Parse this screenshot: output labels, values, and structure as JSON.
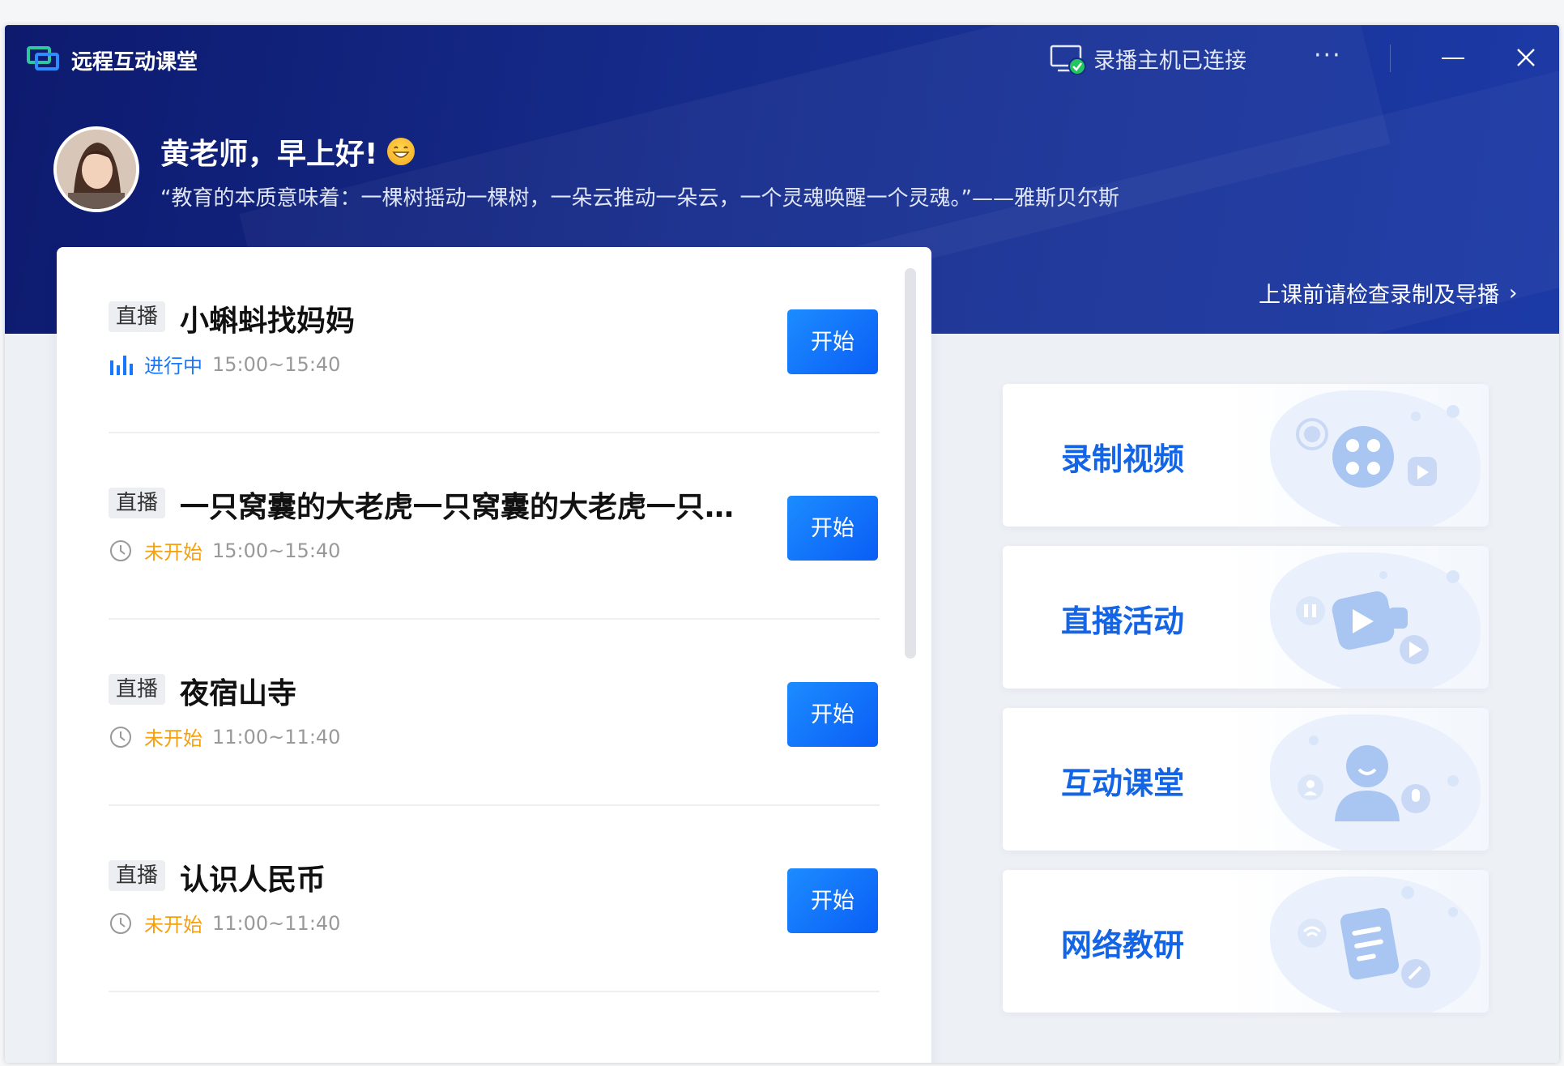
{
  "app": {
    "title": "远程互动课堂"
  },
  "titlebar": {
    "connection_status": "录播主机已连接",
    "more_label": "···"
  },
  "header": {
    "greeting": "黄老师，早上好!",
    "quote": "“教育的本质意味着：一棵树摇动一棵树，一朵云推动一朵云，一个灵魂唤醒一个灵魂。”——雅斯贝尔斯",
    "check_link": "上课前请检查录制及导播"
  },
  "courses": [
    {
      "tag": "直播",
      "title": "小蝌蚪找妈妈",
      "status": "进行中",
      "status_type": "live",
      "time": "15:00~15:40",
      "button": "开始"
    },
    {
      "tag": "直播",
      "title": "一只窝囊的大老虎一只窝囊的大老虎一只窝...",
      "status": "未开始",
      "status_type": "pending",
      "time": "15:00~15:40",
      "button": "开始"
    },
    {
      "tag": "直播",
      "title": "夜宿山寺",
      "status": "未开始",
      "status_type": "pending",
      "time": "11:00~11:40",
      "button": "开始"
    },
    {
      "tag": "直播",
      "title": "认识人民币",
      "status": "未开始",
      "status_type": "pending",
      "time": "11:00~11:40",
      "button": "开始"
    }
  ],
  "features": [
    {
      "label": "录制视频",
      "icon": "film-reel-icon"
    },
    {
      "label": "直播活动",
      "icon": "video-camera-icon"
    },
    {
      "label": "互动课堂",
      "icon": "user-icon"
    },
    {
      "label": "网络教研",
      "icon": "document-icon"
    }
  ],
  "colors": {
    "header_dark": "#0d1a6e",
    "header_light": "#1c3aa6",
    "accent_blue": "#1677ff",
    "pending_orange": "#f5a00f",
    "feature_label": "#1464e6"
  }
}
